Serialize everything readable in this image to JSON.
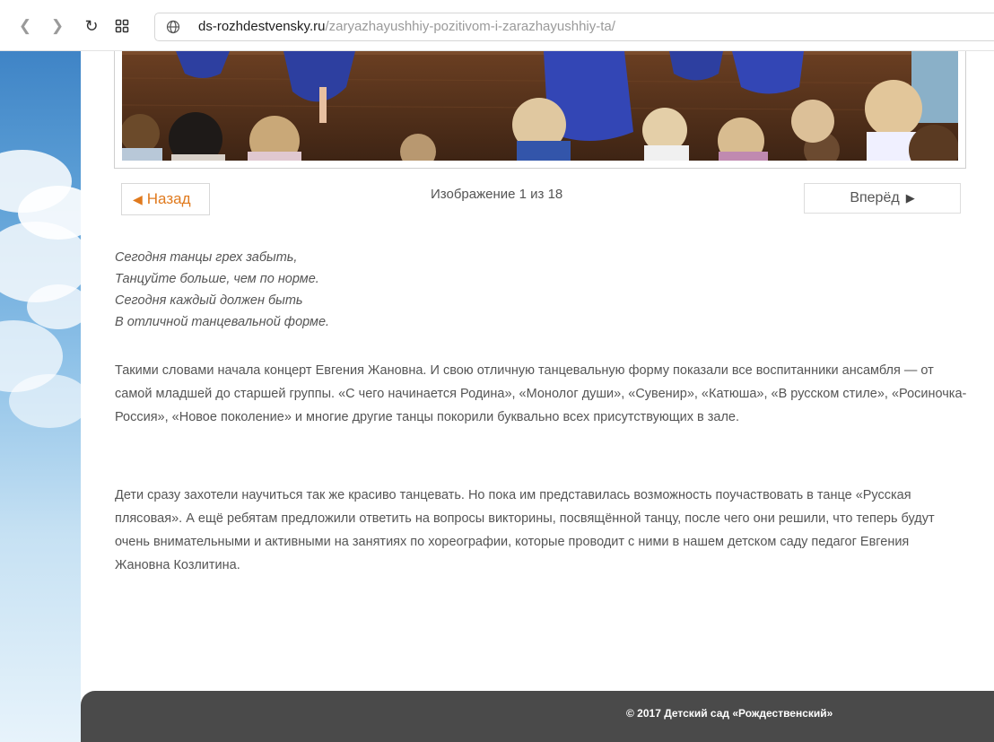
{
  "browser": {
    "url_domain": "ds-rozhdestvensky.ru",
    "url_path": "/zaryazhayushhiy-pozitivom-i-zarazhayushhiy-ta/"
  },
  "gallery": {
    "prev_label": "Назад",
    "next_label": "Вперёд",
    "counter": "Изображение 1 из 18"
  },
  "poem": {
    "lines": [
      "Сегодня танцы грех забыть,",
      "Танцуйте больше, чем по норме.",
      "Сегодня каждый должен быть",
      "В отличной танцевальной форме."
    ]
  },
  "article": {
    "paragraph_1": "Такими словами начала концерт Евгения Жановна. И свою отличную танцевальную форму показали все воспитанники ансамбля — от самой младшей до старшей группы. «С чего начинается Родина», «Монолог души», «Сувенир», «Катюша», «В русском стиле», «Росиночка-Россия», «Новое поколение» и многие другие танцы покорили буквально всех присутствующих в зале.",
    "paragraph_2": "Дети сразу захотели научиться так же красиво танцевать. Но пока им представилась возможность поучаствовать в танце «Русская плясовая».  А ещё ребятам предложили ответить на вопросы викторины, посвящённой танцу, после чего они решили, что теперь будут очень внимательными и активными на занятиях по хореографии, которые проводит с ними  в нашем детском саду педагог Евгения Жановна Козлитина."
  },
  "footer": {
    "copyright": "© 2017 Детский сад «Рождественский»"
  },
  "colors": {
    "accent": "#e07a1e",
    "text": "#555555",
    "footer_bg": "#4a4a4a"
  }
}
